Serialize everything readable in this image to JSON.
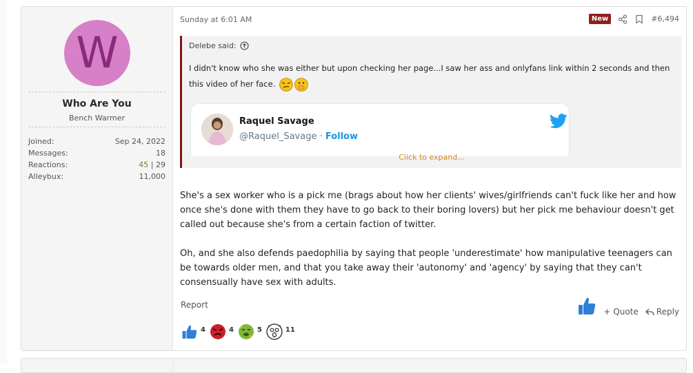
{
  "user": {
    "avatar_letter": "W",
    "avatar_color": "#d680c8",
    "name": "Who Are You",
    "title": "Bench Warmer",
    "stats": {
      "joined_label": "Joined:",
      "joined_value": "Sep 24, 2022",
      "messages_label": "Messages:",
      "messages_value": "18",
      "reactions_label": "Reactions:",
      "reactions_pos": "45",
      "reactions_sep": " | ",
      "reactions_neg": "29",
      "alleybux_label": "Alleybux:",
      "alleybux_value": "11,000"
    }
  },
  "post": {
    "date": "Sunday at 6:01 AM",
    "badge": "New",
    "number": "#6,494",
    "quote": {
      "author": "Delebe said:",
      "text": "I didn't know who she was either but upon checking her page...I saw her ass and onlyfans link within 2 seconds and then this video of her face.",
      "tweet": {
        "name": "Raquel Savage",
        "handle": "@Raquel_Savage",
        "separator": " · ",
        "follow": "Follow"
      },
      "expand": "Click to expand..."
    },
    "body": [
      "She's a sex worker who is a pick me (brags about how her clients' wives/girlfriends can't fuck like her and how once she's done with them they have to go back to their boring lovers) but her pick me behaviour doesn't get called out because she's from a certain faction of twitter.",
      "Oh, and she also defends paedophilia by saying that people 'underestimate' how manipulative teenagers can be towards older men, and that you take away their 'autonomy' and 'agency' by saying that they can't consensually have sex with adults."
    ],
    "report": "Report",
    "actions": {
      "quote": "+ Quote",
      "reply": "Reply"
    },
    "reactions": [
      {
        "icon": "thumbs-up-icon",
        "count": "4"
      },
      {
        "icon": "angry-face-icon",
        "count": "4"
      },
      {
        "icon": "nauseated-face-icon",
        "count": "5"
      },
      {
        "icon": "shocked-face-icon",
        "count": "11"
      }
    ]
  },
  "colors": {
    "accent": "#8f1f1f",
    "like_blue": "#2f7fd8",
    "expand_orange": "#d7871a",
    "positive": "#5b8c2a"
  }
}
